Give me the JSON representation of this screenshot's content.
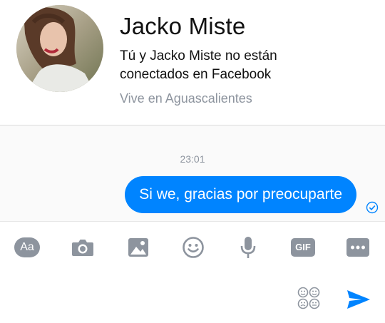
{
  "profile": {
    "name": "Jacko Miste",
    "description": "Tú y Jacko Miste no están conectados en Facebook",
    "location": "Vive en Aguascalientes"
  },
  "conversation": {
    "timestamp": "23:01",
    "messages": [
      {
        "sender": "me",
        "text": "Si we, gracias por preocuparte",
        "status": "sent"
      }
    ]
  },
  "composer": {
    "tools": [
      {
        "name": "aa-icon",
        "label": "Aa"
      },
      {
        "name": "camera-icon"
      },
      {
        "name": "image-icon"
      },
      {
        "name": "emoji-icon"
      },
      {
        "name": "microphone-icon"
      },
      {
        "name": "gif-icon",
        "label": "GIF"
      },
      {
        "name": "more-icon"
      }
    ],
    "input_placeholder": "",
    "extra_icons": [
      "stickers-icon",
      "send-icon"
    ]
  },
  "colors": {
    "accent": "#0084ff",
    "icon_gray": "#8d949e",
    "secondary_text": "#8d949e"
  }
}
